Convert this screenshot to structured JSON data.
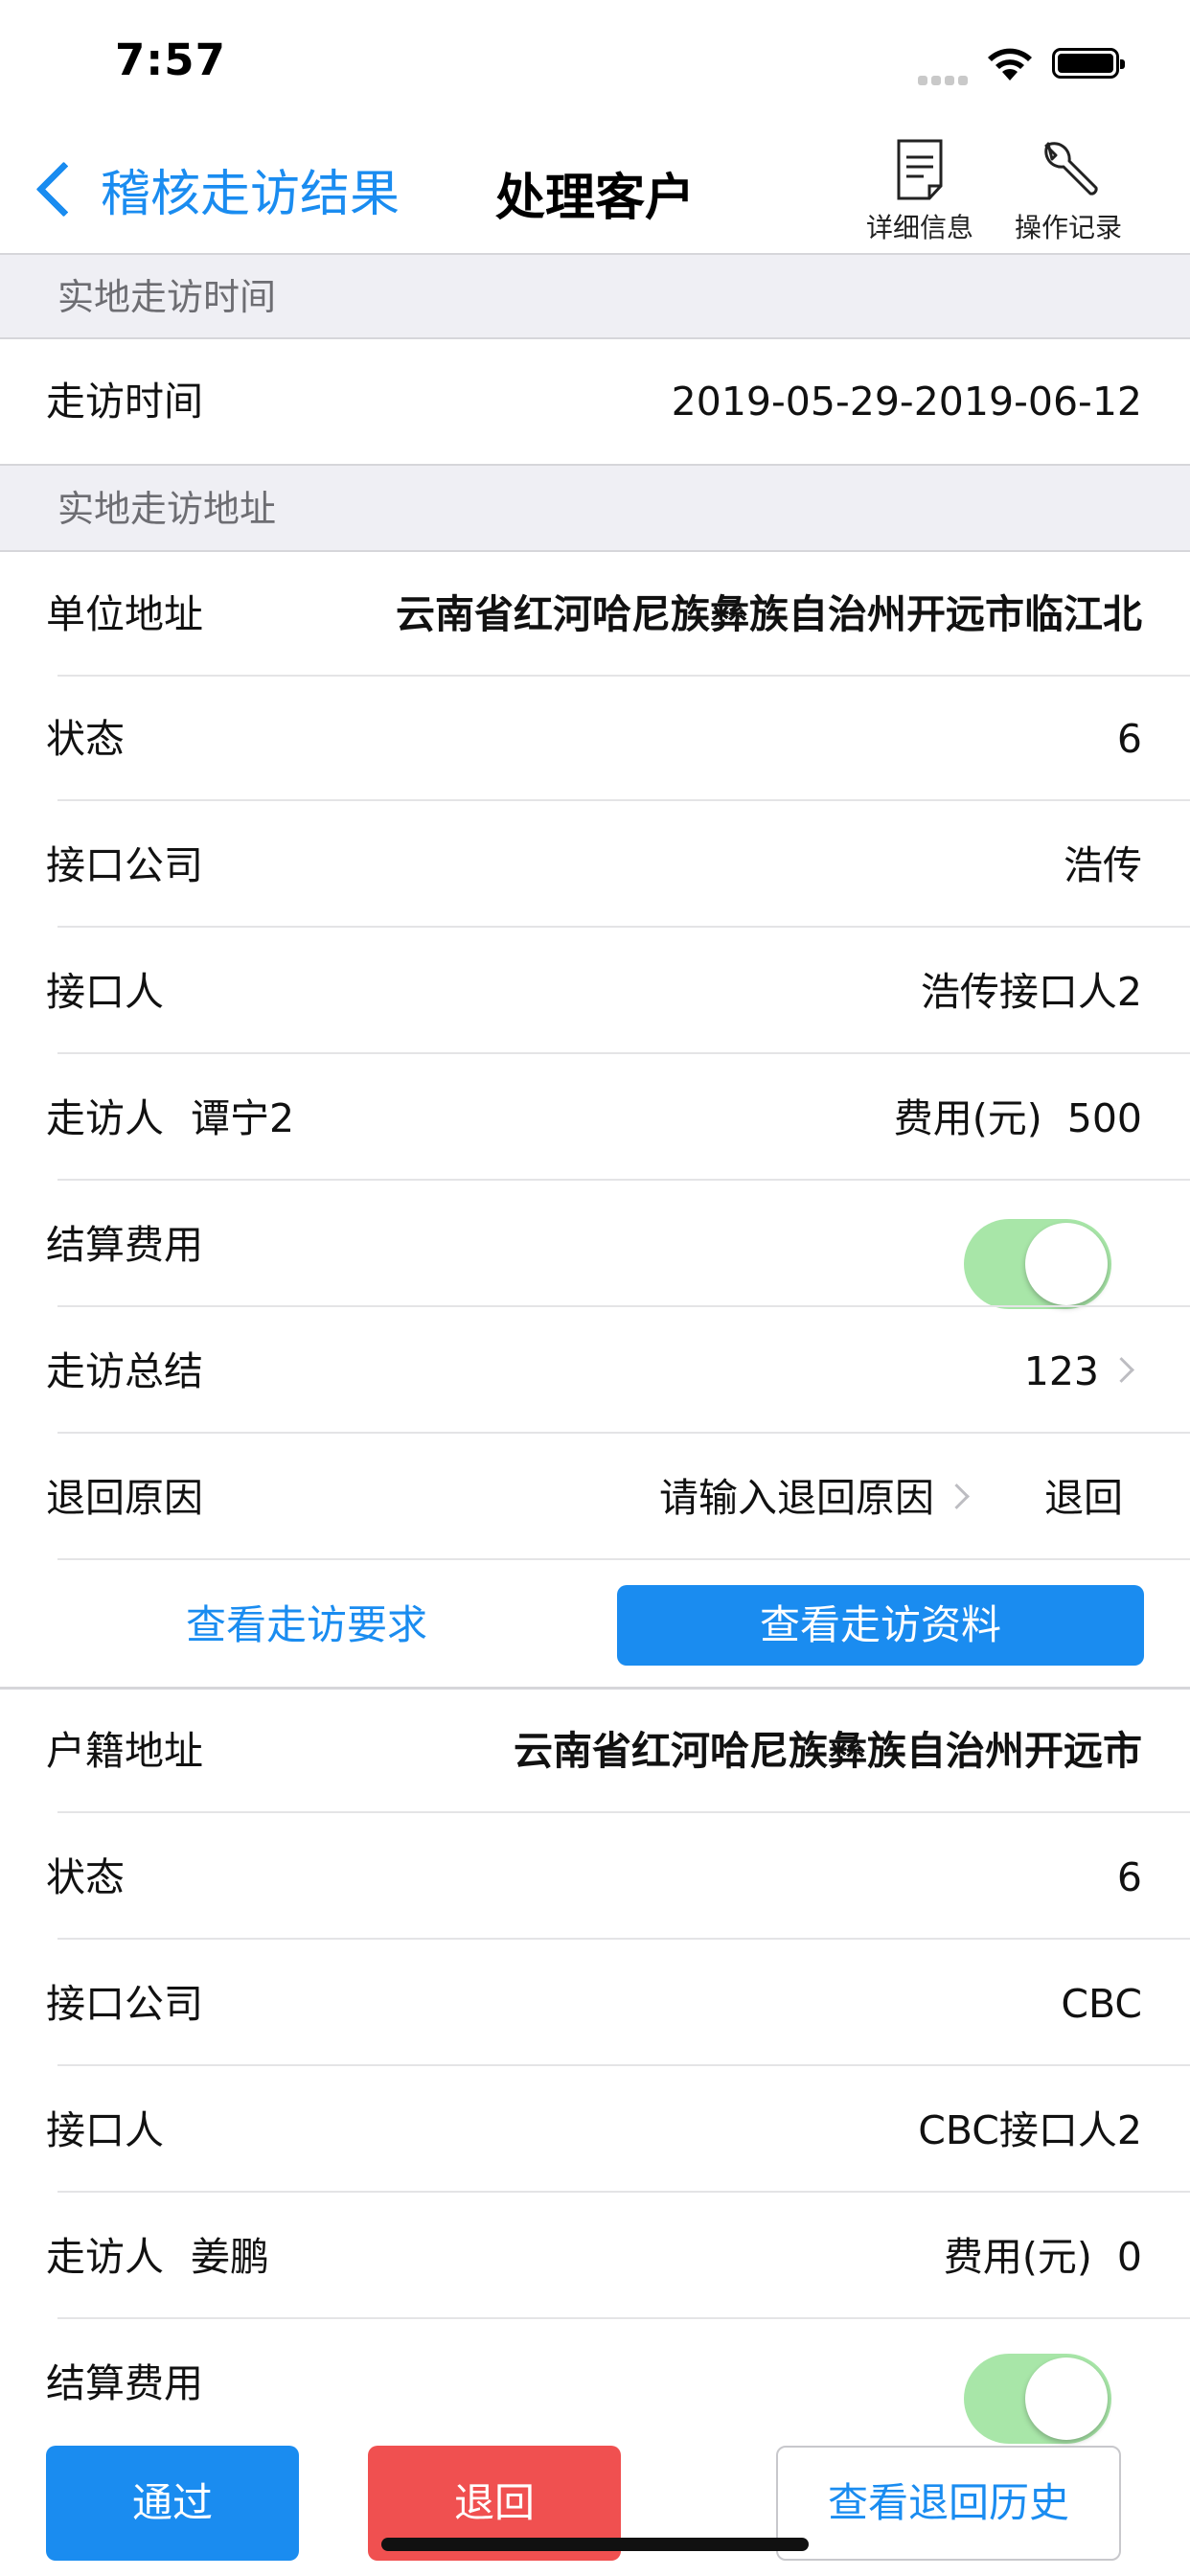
{
  "status_bar": {
    "time": "7:57"
  },
  "nav": {
    "back_label": "稽核走访结果",
    "title": "处理客户",
    "tools": [
      {
        "label": "详细信息",
        "icon": "document-icon"
      },
      {
        "label": "操作记录",
        "icon": "wrench-icon"
      }
    ]
  },
  "section1": {
    "header": "实地走访时间",
    "visit_time_label": "走访时间",
    "visit_time_value": "2019-05-29-2019-06-12"
  },
  "section2": {
    "header": "实地走访地址",
    "work_address_label": "单位地址",
    "work_address_value": "云南省红河哈尼族彝族自治州开远市临江北",
    "status_label": "状态",
    "status_value": "6",
    "company_label": "接口公司",
    "company_value": "浩传",
    "contact_label": "接口人",
    "contact_value": "浩传接口人2",
    "visitor_label": "走访人",
    "visitor_name": "谭宁2",
    "fee_label": "费用(元)",
    "fee_value": "500",
    "settle_label": "结算费用",
    "settle_on": true,
    "summary_label": "走访总结",
    "summary_value": "123",
    "return_reason_label": "退回原因",
    "return_reason_placeholder": "请输入退回原因",
    "return_link": "退回",
    "view_requirements": "查看走访要求",
    "view_materials": "查看走访资料"
  },
  "section3": {
    "household_address_label": "户籍地址",
    "household_address_value": "云南省红河哈尼族彝族自治州开远市",
    "status_label": "状态",
    "status_value": "6",
    "company_label": "接口公司",
    "company_value": "CBC",
    "contact_label": "接口人",
    "contact_value": "CBC接口人2",
    "visitor_label": "走访人",
    "visitor_name": "姜鹏",
    "fee_label": "费用(元)",
    "fee_value": "0",
    "settle_label": "结算费用",
    "settle_on": true
  },
  "bottom": {
    "approve": "通过",
    "reject": "退回",
    "history": "查看退回历史"
  },
  "colors": {
    "accent": "#1a8cf0",
    "danger": "#f05050",
    "toggle_on": "#a8e6a8",
    "section_bg": "#efeff4"
  }
}
